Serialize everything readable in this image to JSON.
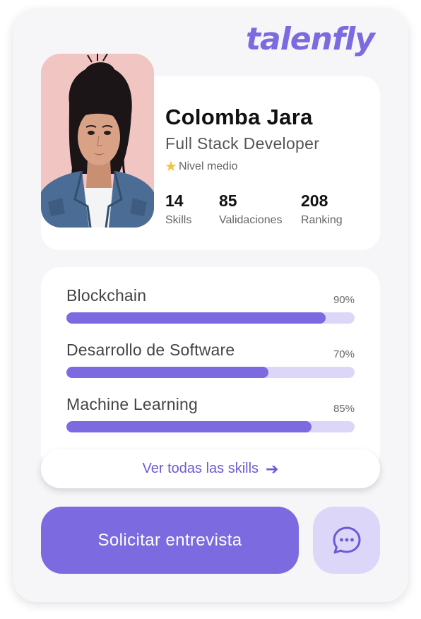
{
  "brand": {
    "logo_text": "talenfly",
    "accent_color": "#7b6ae0",
    "track_color": "#dcd7f8"
  },
  "profile": {
    "name": "Colomba Jara",
    "role": "Full Stack Developer",
    "level_icon": "star-icon",
    "level": "Nivel medio",
    "photo": "avatar-photo",
    "stats": [
      {
        "value": "14",
        "label": "Skills"
      },
      {
        "value": "85",
        "label": "Validaciones"
      },
      {
        "value": "208",
        "label": "Ranking"
      }
    ]
  },
  "skills": [
    {
      "name": "Blockchain",
      "percent_label": "90%",
      "level": 0.9
    },
    {
      "name": "Desarrollo de Software",
      "percent_label": "70%",
      "level": 0.7
    },
    {
      "name": "Machine Learning",
      "percent_label": "85%",
      "level": 0.85
    }
  ],
  "actions": {
    "see_all_label": "Ver todas las skills",
    "see_all_icon": "arrow-right-icon",
    "request_interview_label": "Solicitar entrevista",
    "chat_icon": "chat-bubble-icon"
  }
}
